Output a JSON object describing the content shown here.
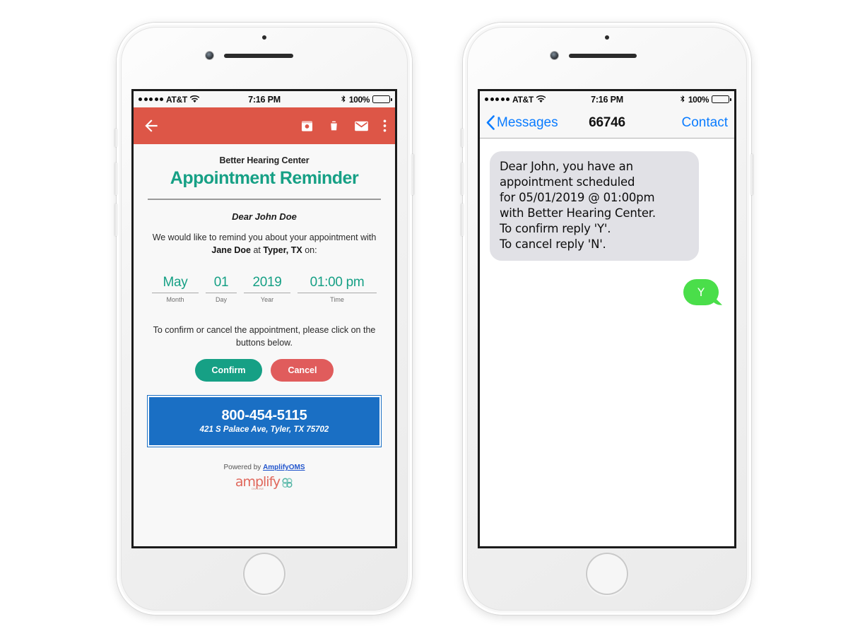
{
  "status_bar": {
    "carrier": "AT&T",
    "time": "7:16 PM",
    "battery_pct": "100%",
    "signal_dots": 5,
    "wifi_icon": "wifi-icon",
    "bluetooth_icon": "bluetooth-icon",
    "battery_icon": "battery-full-icon"
  },
  "email": {
    "appbar": {
      "back_icon": "back-arrow-icon",
      "actions": [
        {
          "name": "archive-icon",
          "label": "Archive"
        },
        {
          "name": "delete-icon",
          "label": "Delete"
        },
        {
          "name": "mark-unread-icon",
          "label": "Mark unread"
        },
        {
          "name": "overflow-menu-icon",
          "label": "More options"
        }
      ],
      "accent_color": "#dd5647"
    },
    "org_name": "Better Hearing Center",
    "title": "Appointment Reminder",
    "salutation": "Dear John Doe",
    "intro_prefix": "We would like to remind you about your appointment with",
    "provider": "Jane Doe",
    "intro_mid": " at ",
    "location": "Typer, TX",
    "intro_suffix": " on:",
    "appointment": {
      "month_value": "May",
      "month_label": "Month",
      "day_value": "01",
      "day_label": "Day",
      "year_value": "2019",
      "year_label": "Year",
      "time_value": "01:00 pm",
      "time_label": "Time"
    },
    "cta_text": "To confirm or cancel the appointment, please click on the buttons below.",
    "confirm_label": "Confirm",
    "cancel_label": "Cancel",
    "banner": {
      "phone": "800-454-5115",
      "address": "421 S Palace Ave, Tyler, TX 75702",
      "color": "#1a6fc4"
    },
    "footer": {
      "powered_by": "Powered by ",
      "brand_link": "AmplifyOMS",
      "logo_text": "amplify",
      "logo_subtext": "ON-LINE",
      "logo_mark": "clover-icon",
      "logo_color": "#e0685c",
      "mark_color": "#4fb3a3"
    },
    "theme_green": "#16a085",
    "theme_red": "#e05c5c"
  },
  "sms": {
    "nav": {
      "back_icon": "chevron-left-icon",
      "back_label": "Messages",
      "title": "66746",
      "contact_label": "Contact",
      "link_color": "#0a7cff"
    },
    "incoming_message": "Dear John, you have an\nappointment scheduled\nfor 05/01/2019 @ 01:00pm\nwith Better Hearing Center.\nTo confirm reply 'Y'.\nTo cancel reply 'N'.",
    "outgoing_message": "Y",
    "incoming_bg": "#e1e1e6",
    "outgoing_bg": "#4ade4a"
  }
}
